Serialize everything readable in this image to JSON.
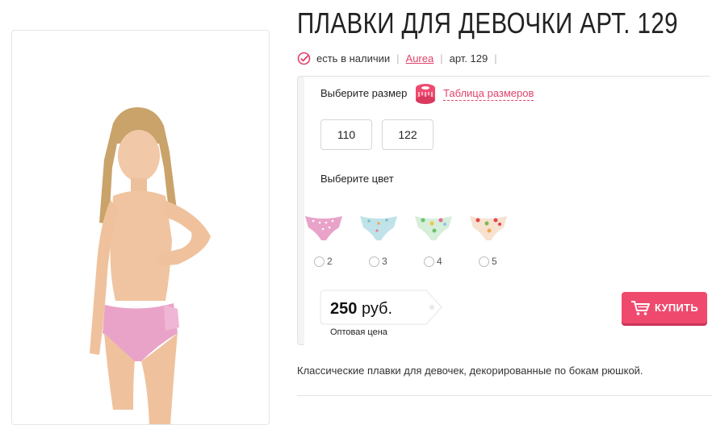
{
  "product": {
    "title": "ПЛАВКИ ДЛЯ ДЕВОЧКИ АРТ. 129",
    "availability": "есть в наличии",
    "brand": "Aurea",
    "article": "арт. 129",
    "description": "Классические плавки для девочек, декорированные по бокам рюшкой."
  },
  "size_picker": {
    "label": "Выберите размер",
    "table_link": "Таблица размеров",
    "sizes": [
      "110",
      "122"
    ]
  },
  "color_picker": {
    "label": "Выберите цвет",
    "options": [
      {
        "label": "2",
        "pattern": "pink-dots"
      },
      {
        "label": "3",
        "pattern": "light-blue-print"
      },
      {
        "label": "4",
        "pattern": "green-floral"
      },
      {
        "label": "5",
        "pattern": "red-floral"
      }
    ]
  },
  "pricing": {
    "amount": "250",
    "currency": "руб.",
    "note": "Оптовая цена"
  },
  "buy_button": {
    "label": "КУПИТЬ"
  },
  "colors": {
    "accent": "#ef4a6e",
    "link": "#e0436a"
  }
}
